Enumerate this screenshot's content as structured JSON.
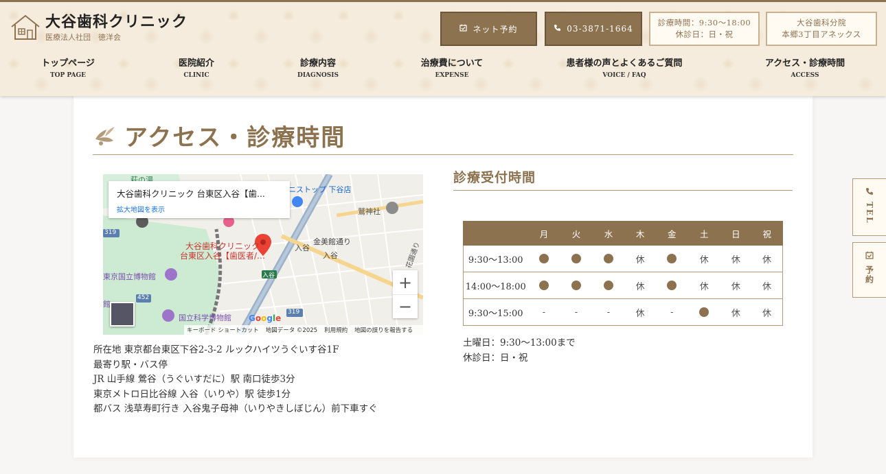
{
  "header": {
    "logo_title": "大谷歯科クリニック",
    "logo_sub": "医療法人社団　徳洋会",
    "net_reserve": "ネット予約",
    "phone": "03-3871-1664",
    "hours_line1": "診療時間：9:30〜18:00",
    "hours_line2": "休診日：日・祝",
    "branch_line1": "大谷歯科分院",
    "branch_line2": "本郷3丁目アネックス"
  },
  "nav": [
    {
      "jp": "トップページ",
      "en": "TOP PAGE"
    },
    {
      "jp": "医院紹介",
      "en": "CLINIC"
    },
    {
      "jp": "診療内容",
      "en": "DIAGNOSIS"
    },
    {
      "jp": "治療費について",
      "en": "EXPENSE"
    },
    {
      "jp": "患者様の声とよくあるご質問",
      "en": "VOICE / FAQ"
    },
    {
      "jp": "アクセス・診療時間",
      "en": "ACCESS"
    }
  ],
  "page_title": "アクセス・診療時間",
  "map": {
    "info_title": "大谷歯科クリニック 台東区入谷【歯...",
    "info_link": "拡大地図を表示",
    "pin_label_1": "大谷歯科クリニック",
    "pin_label_2": "台東区入谷【歯医者/…",
    "labels": {
      "onsen": "萩の湯",
      "convenience": "ニストップ 下谷店",
      "shrine": "鷲神社",
      "kinbi": "金美館通り",
      "iriya": "入谷",
      "iriya_st": "入谷",
      "museum1": "東京国立博物館",
      "museum2": "国立科学博物館",
      "road_319a": "319",
      "road_319b": "319",
      "road_452": "452",
      "iriya_sign": "入谷",
      "hanazono": "花園通り",
      "kan": "館"
    },
    "google": "Google",
    "footer_shortcuts": "キーボード ショートカット",
    "footer_data": "地図データ ©2025",
    "footer_terms": "利用規約",
    "footer_report": "地図の誤りを報告する"
  },
  "address": {
    "line1": "所在地 東京都台東区下谷2-3-2 ルックハイツうぐいす谷1F",
    "line2": "最寄り駅・バス停",
    "line3": "JR 山手線 鶯谷（うぐいすだに）駅 南口徒歩3分",
    "line4": "東京メトロ日比谷線 入谷（いりや）駅 徒歩1分",
    "line5": "都バス 浅草寿町行き 入谷鬼子母神（いりやきしぼじん）前下車すぐ"
  },
  "schedule": {
    "title": "診療受付時間",
    "days": [
      "月",
      "火",
      "水",
      "木",
      "金",
      "土",
      "日",
      "祝"
    ],
    "rows": [
      {
        "time": "9:30〜13:00",
        "cells": [
          "open",
          "open",
          "open",
          "休",
          "open",
          "休",
          "休",
          "休"
        ]
      },
      {
        "time": "14:00〜18:00",
        "cells": [
          "open",
          "open",
          "open",
          "休",
          "open",
          "休",
          "休",
          "休"
        ]
      },
      {
        "time": "9:30〜15:00",
        "cells": [
          "-",
          "-",
          "-",
          "休",
          "-",
          "open",
          "休",
          "休"
        ]
      }
    ],
    "note1": "土曜日：9:30〜13:00まで",
    "note2": "休診日：日・祝"
  },
  "side": {
    "tel": "TEL",
    "reserve": "予約"
  },
  "colors": {
    "accent": "#8d7250",
    "header_bg": "#f6ecdd",
    "border": "#b39a78"
  }
}
